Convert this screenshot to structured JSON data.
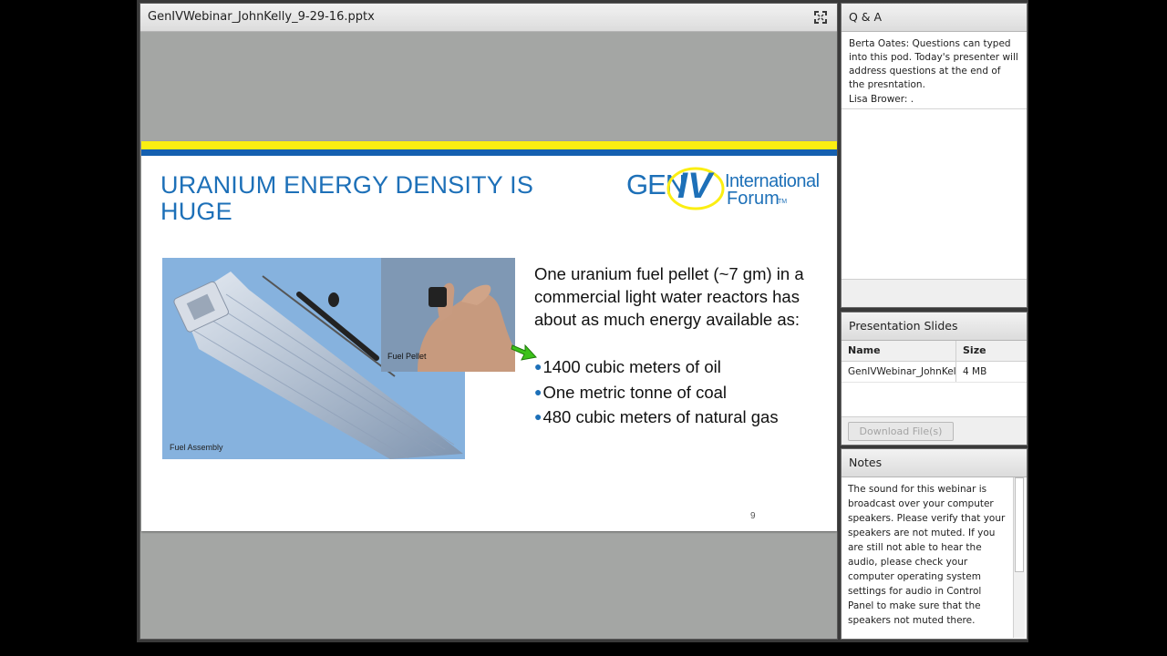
{
  "share_pod": {
    "title": "GenIVWebinar_JohnKelly_9-29-16.pptx"
  },
  "slide": {
    "title": "URANIUM ENERGY DENSITY IS HUGE",
    "logo_text": "GEN IV International Forum",
    "image_caption_assembly": "Fuel Assembly",
    "image_caption_pellet": "Fuel Pellet",
    "body": "One uranium fuel pellet (~7 gm) in a commercial light water reactors has about as much energy available as:",
    "bullets": [
      "1400 cubic meters of oil",
      "One metric tonne of coal",
      "480 cubic meters of natural gas"
    ],
    "page_number": "9",
    "colors": {
      "title": "#1d70b8",
      "band_yellow": "#fbee12",
      "band_blue": "#1560b0"
    }
  },
  "qa_pod": {
    "title": "Q & A",
    "message": "Berta Oates: Questions can typed into this pod. Today's presenter will address questions at the end of the presntation.",
    "lisa": "Lisa Brower: ."
  },
  "slides_pod": {
    "title": "Presentation Slides",
    "columns": [
      "Name",
      "Size"
    ],
    "rows": [
      {
        "name": "GenIVWebinar_JohnKelly",
        "size": "4 MB"
      }
    ],
    "download_label": "Download File(s)"
  },
  "notes_pod": {
    "title": "Notes",
    "text": "The sound for this webinar is broadcast over your computer speakers.  Please verify that your speakers are not muted.  If you are still not able to hear the audio, please check your computer operating system settings for audio in Control Panel to make sure that the speakers not muted there."
  },
  "icons": [
    "fullscreen-icon",
    "green-arrow-icon"
  ]
}
